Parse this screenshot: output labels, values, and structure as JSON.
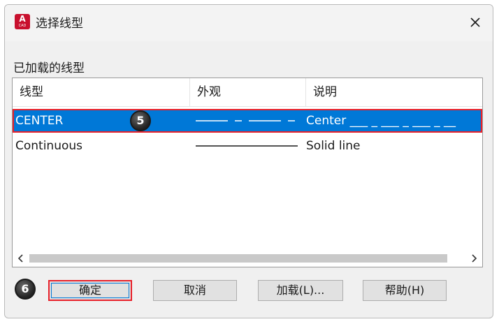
{
  "window": {
    "title": "选择线型",
    "app_icon_letter": "A",
    "app_icon_sub": "CAD"
  },
  "section_label": "已加载的线型",
  "table": {
    "columns": [
      "线型",
      "外观",
      "说明"
    ],
    "rows": [
      {
        "name": "CENTER",
        "preview": "—— - —— -",
        "description": "Center ___ _ ___ _ ___ _ __",
        "selected": true
      },
      {
        "name": "Continuous",
        "preview": "————————",
        "description": "Solid line",
        "selected": false
      }
    ]
  },
  "scrollbar": {
    "left_arrow": "<",
    "right_arrow": ">"
  },
  "buttons": {
    "ok": "确定",
    "cancel": "取消",
    "load": "加载(L)...",
    "help": "帮助(H)"
  },
  "step_badges": {
    "step_row": "5",
    "step_ok": "6"
  },
  "colors": {
    "selection": "#0078d7",
    "highlight_outline": "#e8212a",
    "dialog_bg": "#f0f0f0"
  },
  "icons": {
    "close": "close-icon",
    "app": "autocad-app-icon"
  }
}
